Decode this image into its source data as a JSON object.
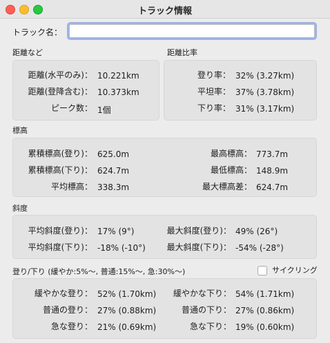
{
  "window": {
    "title": "トラック情報"
  },
  "track_name": {
    "label": "トラック名：",
    "value": ""
  },
  "distance": {
    "title": "距離など",
    "rows": [
      {
        "label": "距離(水平のみ)：",
        "value": "10.221km"
      },
      {
        "label": "距離(登降含む)：",
        "value": "10.373km"
      },
      {
        "label": "ピーク数：",
        "value": "1個"
      }
    ]
  },
  "distance_ratio": {
    "title": "距離比率",
    "rows": [
      {
        "label": "登り率：",
        "value": "32% (3.27km)"
      },
      {
        "label": "平坦率：",
        "value": "37% (3.78km)"
      },
      {
        "label": "下り率：",
        "value": "31% (3.17km)"
      }
    ]
  },
  "elevation": {
    "title": "標高",
    "left": [
      {
        "label": "累積標高(登り)：",
        "value": "625.0m"
      },
      {
        "label": "累積標高(下り)：",
        "value": "624.7m"
      },
      {
        "label": "平均標高：",
        "value": "338.3m"
      }
    ],
    "right": [
      {
        "label": "最高標高：",
        "value": "773.7m"
      },
      {
        "label": "最低標高：",
        "value": "148.9m"
      },
      {
        "label": "最大標高差：",
        "value": "624.7m"
      }
    ]
  },
  "slope": {
    "title": "斜度",
    "left": [
      {
        "label": "平均斜度(登り)：",
        "value": "17% (9°)"
      },
      {
        "label": "平均斜度(下り)：",
        "value": "-18% (-10°)"
      }
    ],
    "right": [
      {
        "label": "最大斜度(登り)：",
        "value": "49% (26°)"
      },
      {
        "label": "最大斜度(下り)：",
        "value": "-54% (-28°)"
      }
    ]
  },
  "updown": {
    "title": "登り/下り (緩やか:5%〜, 普通:15%〜, 急:30%〜)",
    "cycling_label": "サイクリング",
    "cycling_checked": false,
    "left": [
      {
        "label": "緩やかな登り：",
        "value": "52% (1.70km)"
      },
      {
        "label": "普通の登り：",
        "value": "27% (0.88km)"
      },
      {
        "label": "急な登り：",
        "value": "21% (0.69km)"
      }
    ],
    "right": [
      {
        "label": "緩やかな下り：",
        "value": "54% (1.71km)"
      },
      {
        "label": "普通の下り：",
        "value": "27% (0.86km)"
      },
      {
        "label": "急な下り：",
        "value": "19% (0.60km)"
      }
    ]
  }
}
